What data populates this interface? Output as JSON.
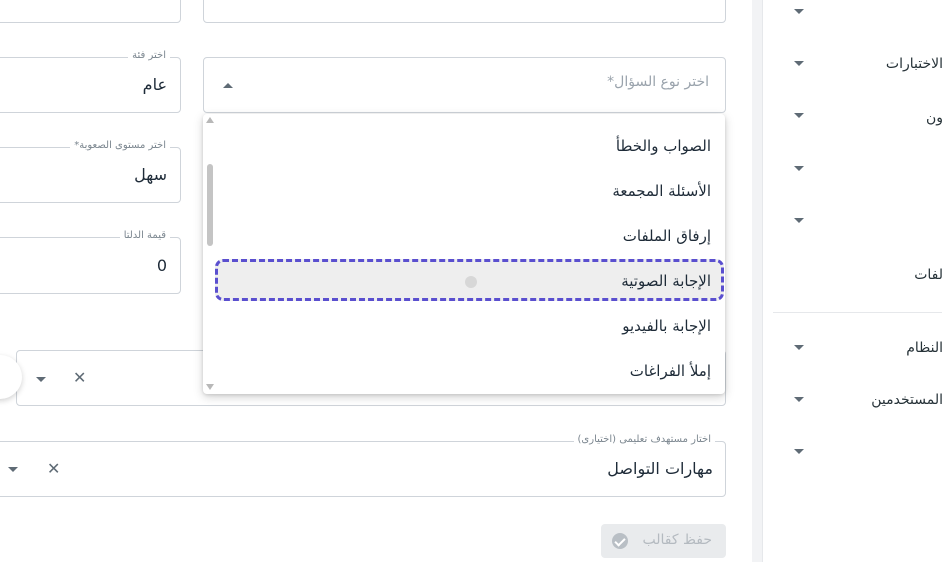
{
  "form": {
    "top_left_field_value": "",
    "category": {
      "label": "اختر فئة",
      "value": "عام"
    },
    "difficulty": {
      "label": "اختر مستوى الصعوبة*",
      "value": "سهل"
    },
    "min_value": {
      "label": "قيمة الدلتا",
      "value": "0"
    },
    "question_type": {
      "placeholder": "اختر نوع السؤال*"
    },
    "target": {
      "label": "اختار مستهدف تعليمى (اختيارى)",
      "value": "مهارات التواصل"
    },
    "save_button": {
      "label": "حفظ كقالب"
    }
  },
  "dropdown": {
    "options": [
      "الصواب والخطأ",
      "الأسئلة المجمعة",
      "إرفاق الملفات",
      "الإجابة الصوتية",
      "الإجابة بالفيديو",
      "إملأ الفراغات"
    ],
    "highlighted_index": 3
  },
  "sidebar": {
    "items": [
      "",
      "الاختبارات",
      "ون",
      "",
      "",
      "لفات",
      "النظام",
      "المستخدمين",
      ""
    ]
  },
  "colors": {
    "highlight_border": "#5a4fcf",
    "highlight_bg": "#eeeeee",
    "text": "#1e2b38"
  }
}
